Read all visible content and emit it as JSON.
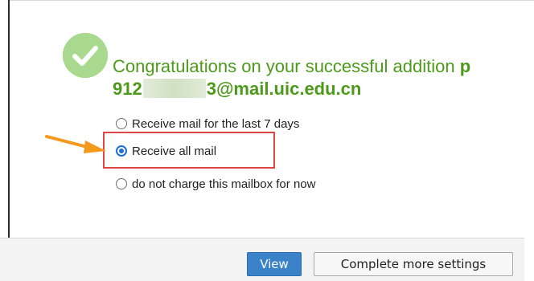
{
  "dialog": {
    "title_line1": "Congratulations on your successful addition ",
    "title_line1_bold": "p",
    "title_line2_prefix": "912",
    "title_line2_suffix": "3@mail.uic.edu.cn"
  },
  "options": [
    {
      "label": "Receive mail for the last 7 days",
      "checked": false
    },
    {
      "label": "Receive all mail",
      "checked": true
    },
    {
      "label": "do not charge this mailbox for now",
      "checked": false
    }
  ],
  "buttons": {
    "view": "View",
    "more_settings": "Complete more settings"
  },
  "colors": {
    "success_green": "#4c9a1a",
    "icon_green": "#a9d98e",
    "primary_blue": "#3b83c9",
    "highlight_red": "#e04545",
    "arrow_orange": "#f39a1c"
  },
  "icons": {
    "success": "check-circle-icon",
    "arrow": "arrow-right-icon"
  }
}
